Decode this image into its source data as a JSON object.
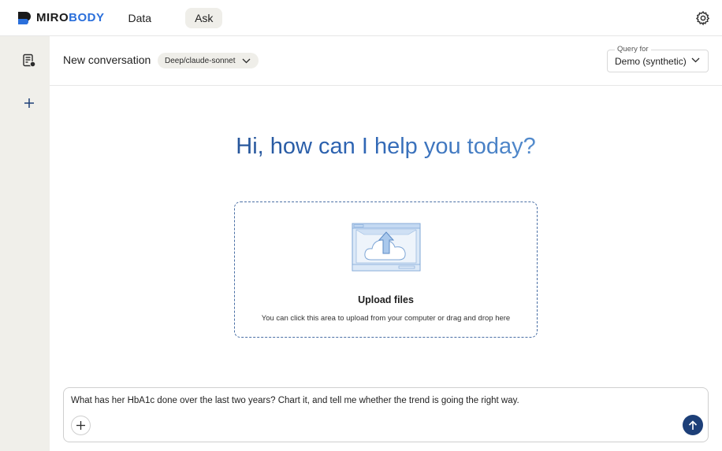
{
  "brand": {
    "name_part1": "MIRO",
    "name_part2": "BODY",
    "accent_color": "#2a6fdb"
  },
  "nav": {
    "tabs": [
      {
        "label": "Data",
        "active": false
      },
      {
        "label": "Ask",
        "active": true
      }
    ]
  },
  "icons": {
    "settings": "gear-icon",
    "history": "conversation-history-icon",
    "new": "plus-icon",
    "attach": "plus-icon",
    "send": "arrow-up-icon"
  },
  "conversation": {
    "title": "New conversation",
    "model": "Deep/claude-sonnet",
    "query_for_label": "Query for",
    "query_for_value": "Demo (synthetic)"
  },
  "greeting": "Hi, how can I help you today?",
  "upload": {
    "title": "Upload files",
    "subtitle": "You can click this area to upload from your computer or drag and drop here"
  },
  "composer": {
    "text": "What has her HbA1c done over the last two years? Chart it, and tell me whether the trend is going the right way."
  },
  "colors": {
    "send_button": "#1d3f78",
    "sidebar_bg": "#f0efea",
    "upload_border": "#4a6fa5"
  }
}
